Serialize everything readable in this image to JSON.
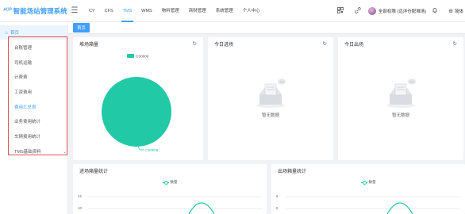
{
  "app": {
    "logo_text": "ᴬᴼᴾ",
    "title": "智能场站管理系统"
  },
  "topnav": {
    "items": [
      {
        "label": "CY",
        "active": false
      },
      {
        "label": "CFS",
        "active": false
      },
      {
        "label": "TMS",
        "active": true
      },
      {
        "label": "WMS",
        "active": false
      },
      {
        "label": "物料管理",
        "active": false
      },
      {
        "label": "商财管理",
        "active": false
      },
      {
        "label": "系统管理",
        "active": false
      },
      {
        "label": "个人中心",
        "active": false
      }
    ],
    "user_label": "全部权限 (远洋仓配堆场)",
    "lang_label": "简体"
  },
  "sidebar": {
    "home_label": "首页",
    "items": [
      {
        "label": "台账管理",
        "active": false
      },
      {
        "label": "司机运输",
        "active": false
      },
      {
        "label": "计费费",
        "active": false
      },
      {
        "label": "工资费用",
        "active": false
      },
      {
        "label": "费用汇总表",
        "active": true
      },
      {
        "label": "业务费用统计",
        "active": false
      },
      {
        "label": "车辆费用统计",
        "active": false
      },
      {
        "label": "TMS基础资料",
        "active": false
      }
    ]
  },
  "tagbar": {
    "active_tag": "首页"
  },
  "cards": {
    "stock": {
      "title": "堆场箱量"
    },
    "in_today": {
      "title": "今日进场",
      "empty_text": "暂无数据"
    },
    "out_today": {
      "title": "今日出场",
      "empty_text": "暂无数据"
    },
    "in_stats": {
      "title": "进场箱量统计",
      "legend": "数量"
    },
    "out_stats": {
      "title": "出场箱量统计",
      "legend": "数量"
    }
  },
  "chart_data": [
    {
      "type": "pie",
      "title": "堆场箱量",
      "legend": [
        "CS0009"
      ],
      "slices": [
        {
          "label": "CS0009",
          "value": 100
        }
      ],
      "colors": [
        "#22c9a7"
      ]
    },
    {
      "type": "line",
      "title": "进场箱量统计",
      "series": [
        {
          "name": "数量"
        }
      ],
      "y_ticks": [
        12,
        10
      ]
    },
    {
      "type": "line",
      "title": "出场箱量统计",
      "series": [
        {
          "name": "数量"
        }
      ],
      "y_ticks": [
        6,
        5
      ]
    }
  ],
  "colors": {
    "primary": "#409eff",
    "accent": "#22c9a7",
    "highlight_border": "#e05252"
  }
}
